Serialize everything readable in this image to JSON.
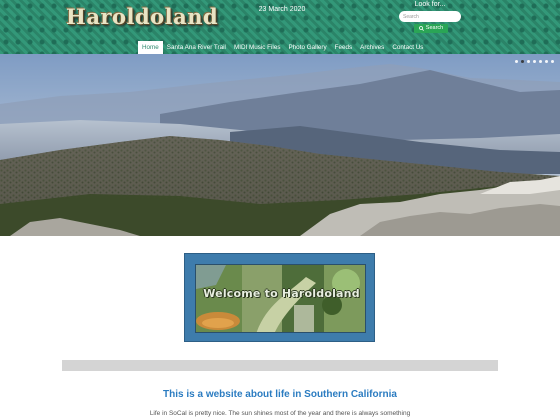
{
  "header": {
    "logo_text": "Haroldoland",
    "date": "23 March 2020",
    "search_label": "Look for...",
    "search_placeholder": "Search",
    "search_button": "Search"
  },
  "nav": {
    "items": [
      {
        "label": "Home",
        "active": true
      },
      {
        "label": "Santa Ana River Trail",
        "active": false
      },
      {
        "label": "MIDI Music Files",
        "active": false
      },
      {
        "label": "Photo Gallery",
        "active": false
      },
      {
        "label": "Feeds",
        "active": false
      },
      {
        "label": "Archives",
        "active": false
      },
      {
        "label": "Contact Us",
        "active": false
      }
    ]
  },
  "slideshow": {
    "dot_count": 7,
    "active_index": 1
  },
  "welcome": {
    "text": "Welcome to Haroldoland"
  },
  "content": {
    "subtitle": "This is a website about life in Southern California",
    "intro": "Life in SoCal is pretty nice. The sun shines most of the year and there is always something"
  },
  "colors": {
    "header": "#2e8a6e",
    "accent": "#2b7cc1",
    "search_button": "#2aa556"
  }
}
